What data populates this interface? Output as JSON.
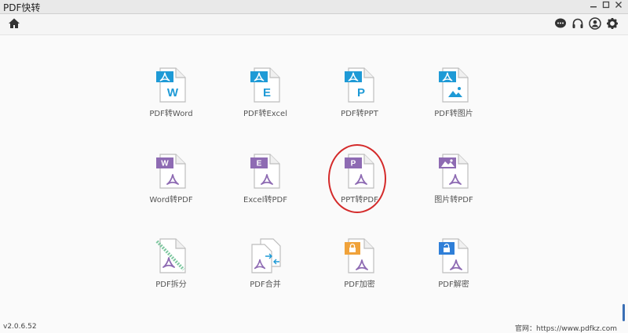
{
  "window": {
    "title": "PDF快转",
    "controls": [
      "minimize-icon",
      "maximize-icon",
      "close-icon"
    ]
  },
  "toolbar": {
    "home_icon": "home-icon",
    "right_icons": [
      "chat-icon",
      "headset-icon",
      "user-icon",
      "gear-icon"
    ]
  },
  "colors": {
    "pdf_to_x": "#1e9ad6",
    "x_to_pdf": "#8e6bb3",
    "lock": "#f0a23a",
    "unlock": "#2f7fd8",
    "highlight": "#d42a2a"
  },
  "tools": [
    {
      "label": "PDF转Word",
      "letter": "W"
    },
    {
      "label": "PDF转Excel",
      "letter": "E"
    },
    {
      "label": "PDF转PPT",
      "letter": "P"
    },
    {
      "label": "PDF转图片",
      "letter": ""
    },
    {
      "label": "Word转PDF",
      "letter": "W"
    },
    {
      "label": "Excel转PDF",
      "letter": "E"
    },
    {
      "label": "PPT转PDF",
      "letter": "P"
    },
    {
      "label": "图片转PDF",
      "letter": ""
    },
    {
      "label": "PDF拆分",
      "letter": ""
    },
    {
      "label": "PDF合并",
      "letter": ""
    },
    {
      "label": "PDF加密",
      "letter": ""
    },
    {
      "label": "PDF解密",
      "letter": ""
    }
  ],
  "footer": {
    "version": "v2.0.6.52",
    "website": "官网：https://www.pdfkz.com"
  }
}
